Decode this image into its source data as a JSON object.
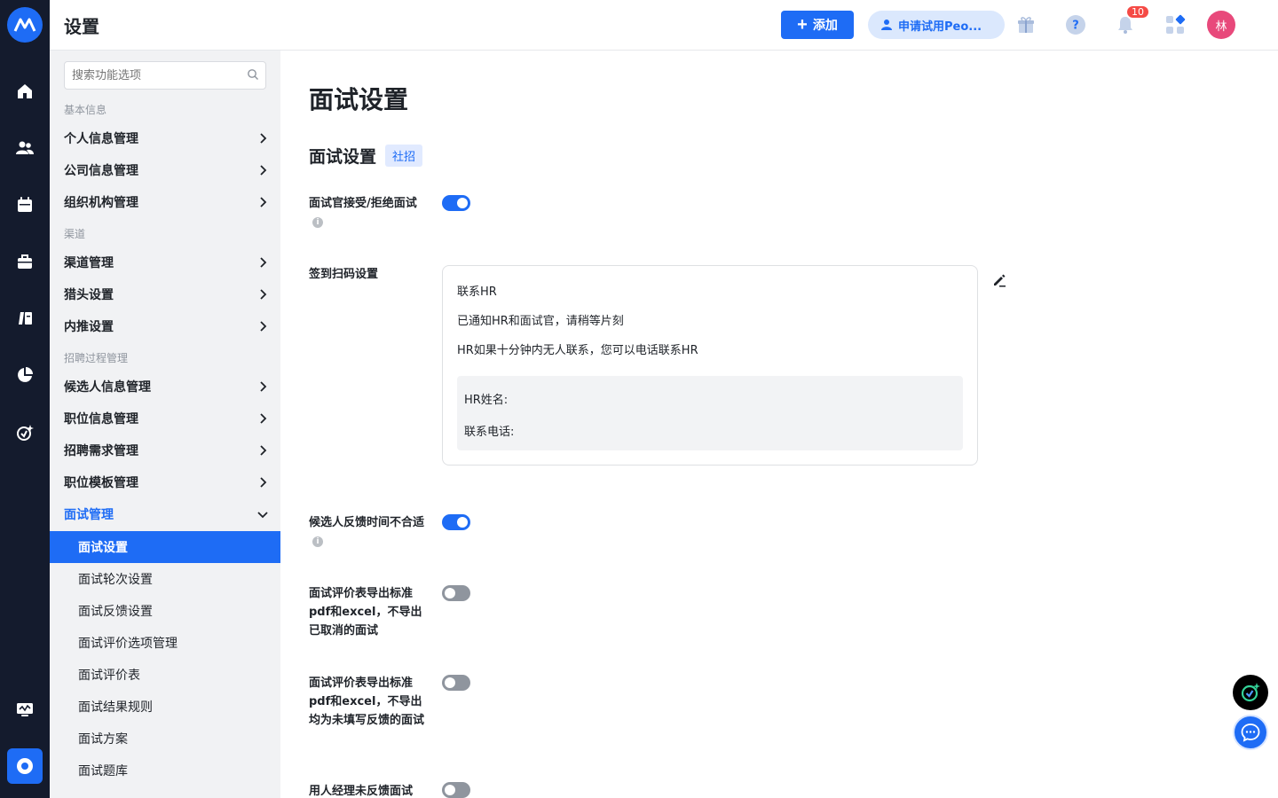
{
  "header": {
    "title": "设置",
    "add_label": "添加",
    "trial_label": "申请试用Peo...",
    "notification_count": "10",
    "avatar_text": "林"
  },
  "sidebar": {
    "search_placeholder": "搜索功能选项",
    "groups": {
      "basic": "基本信息",
      "channel": "渠道",
      "process": "招聘过程管理"
    },
    "items": {
      "personal": "个人信息管理",
      "company": "公司信息管理",
      "org": "组织机构管理",
      "channel_mgmt": "渠道管理",
      "headhunter": "猎头设置",
      "referral": "内推设置",
      "candidate": "候选人信息管理",
      "position": "职位信息管理",
      "demand": "招聘需求管理",
      "template": "职位模板管理",
      "interview": "面试管理"
    },
    "sub_items": {
      "settings": "面试设置",
      "rounds": "面试轮次设置",
      "feedback": "面试反馈设置",
      "eval_options": "面试评价选项管理",
      "eval_form": "面试评价表",
      "result_rules": "面试结果规则",
      "plan": "面试方案",
      "question_bank": "面试题库"
    }
  },
  "main": {
    "page_title": "面试设置",
    "section_title": "面试设置",
    "section_tag": "社招",
    "settings": {
      "accept_reject": {
        "label": "面试官接受/拒绝面试",
        "enabled": true
      },
      "checkin": {
        "label": "签到扫码设置"
      },
      "feedback_time": {
        "label": "候选人反馈时间不合适",
        "enabled": true
      },
      "export_cancel": {
        "label": "面试评价表导出标准pdf和excel，不导出已取消的面试",
        "enabled": false
      },
      "export_unfilled": {
        "label": "面试评价表导出标准pdf和excel，不导出均为未填写反馈的面试",
        "enabled": false
      },
      "manager_feedback": {
        "label": "用人经理未反馈面试",
        "enabled": false
      }
    },
    "checkin_card": {
      "title": "联系HR",
      "line1": "已通知HR和面试官，请稍等片刻",
      "line2": "HR如果十分钟内无人联系，您可以电话联系HR",
      "hr_name_label": "HR姓名:",
      "hr_phone_label": "联系电话:"
    }
  },
  "colors": {
    "accent": "#1e6cf5",
    "rail_bg": "#141b2d",
    "sidebar_bg": "#f1f2f4"
  }
}
